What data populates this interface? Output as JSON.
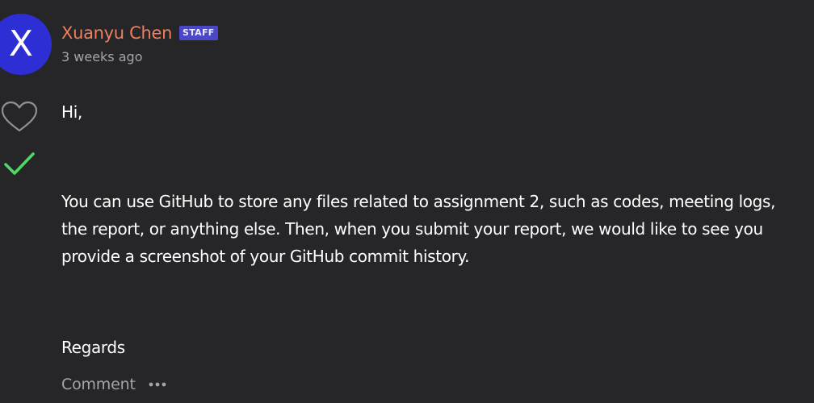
{
  "author": {
    "initial": "X",
    "name": "Xuanyu Chen",
    "badge": "STAFF",
    "timestamp": "3 weeks ago",
    "name_color": "#f07f5e",
    "avatar_color": "#2d2fd4",
    "badge_color": "#4a48c8"
  },
  "post": {
    "greeting": "Hi,",
    "body": "You can use GitHub to store any files related to assignment 2, such as codes, meeting logs, the report, or anything else. Then, when you submit your report, we would like to see you provide a screenshot of your GitHub commit history.",
    "signoff": "Regards"
  },
  "icons": {
    "like": "heart-outline-icon",
    "answered": "checkmark-icon",
    "more": "ellipsis-icon"
  },
  "colors": {
    "background": "#262628",
    "checkmark": "#4cd964",
    "muted": "#a5a5a8"
  },
  "actions": {
    "comment_label": "Comment"
  }
}
